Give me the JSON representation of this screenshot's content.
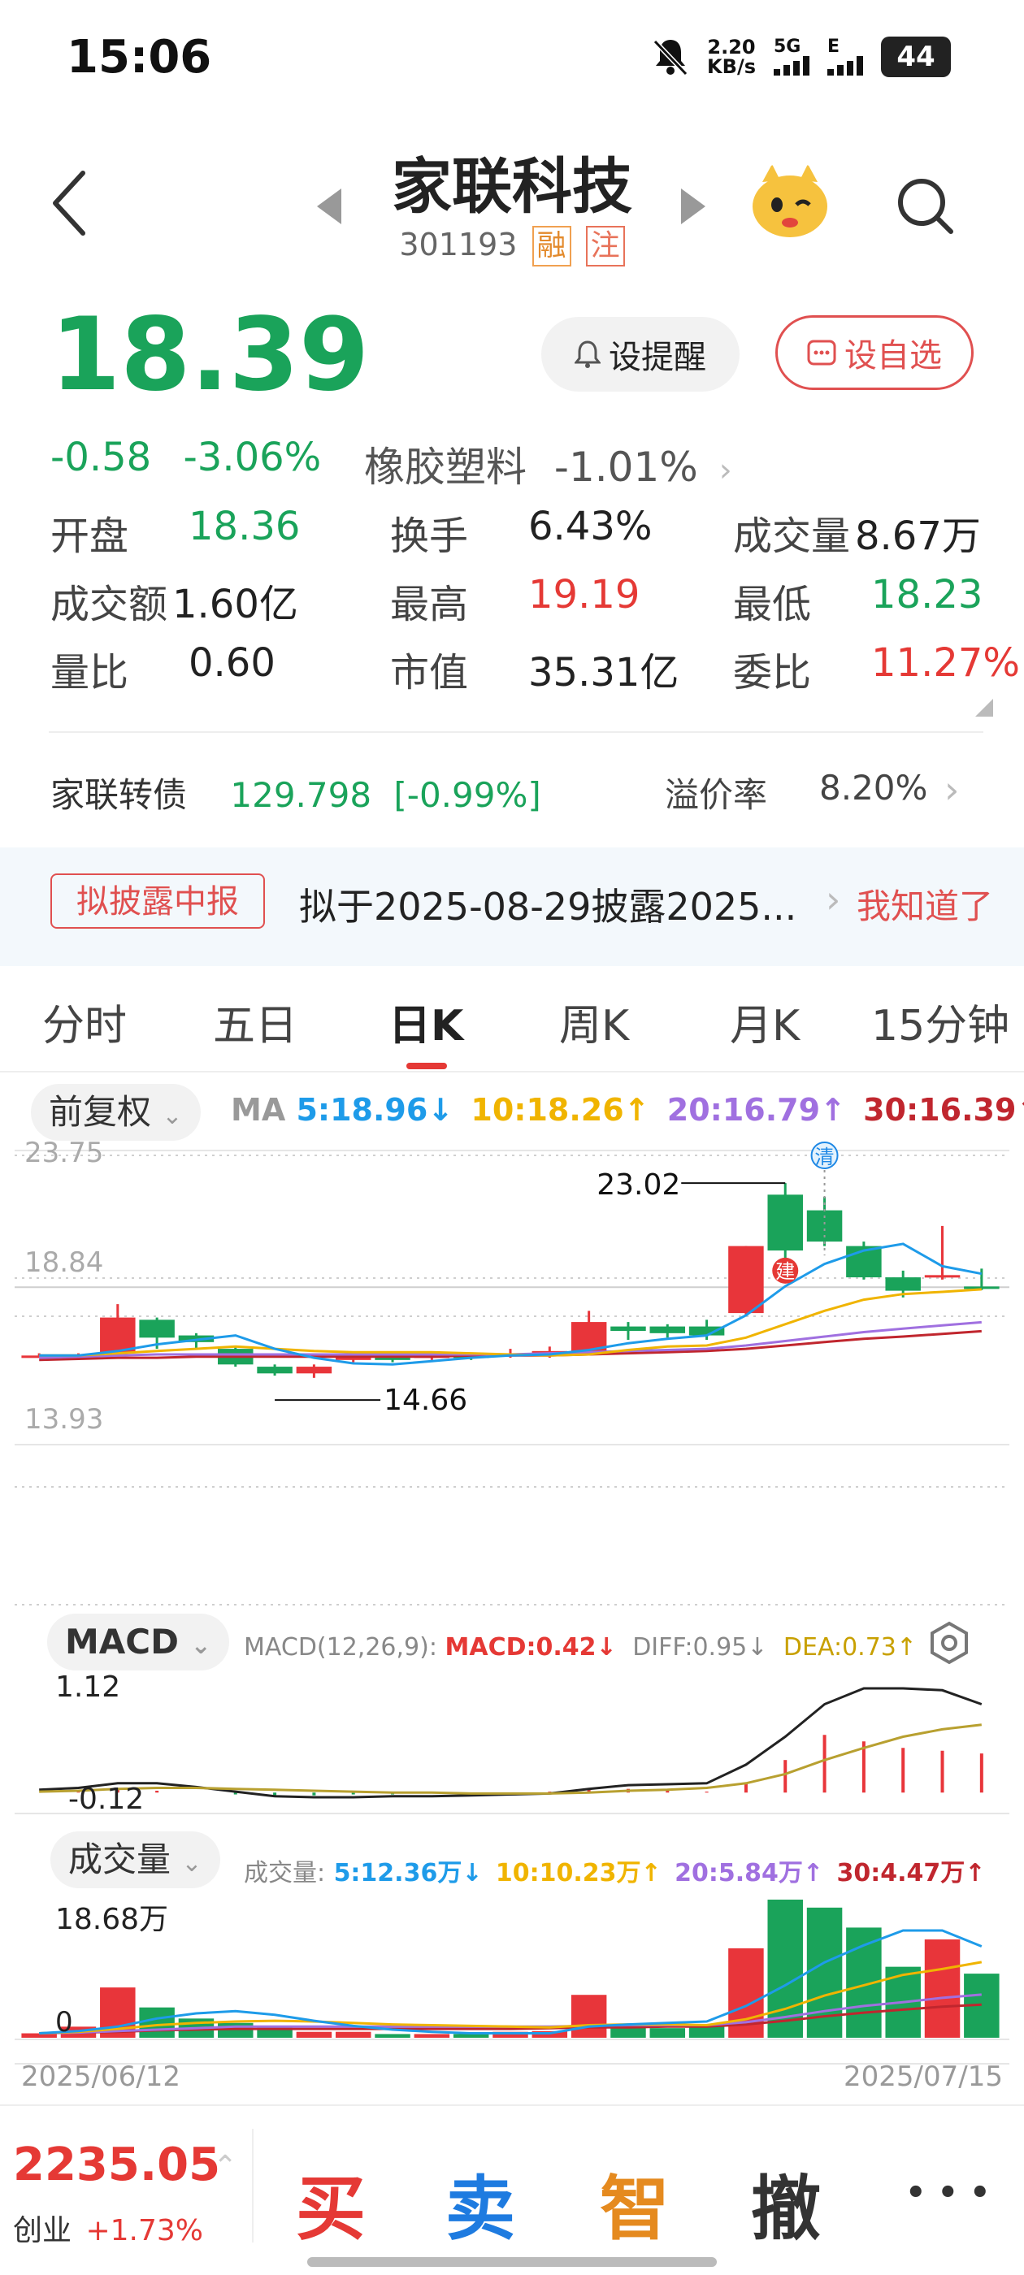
{
  "status_bar": {
    "time": "15:06",
    "net_speed_value": "2.20",
    "net_speed_unit": "KB/s",
    "net_5g": "5G",
    "net_e": "E",
    "battery": "44"
  },
  "header": {
    "title": "家联科技",
    "code": "301193",
    "tag_margin": "融",
    "tag_notice": "注"
  },
  "quote": {
    "price": "18.39",
    "change": "-0.58",
    "change_pct": "-3.06%",
    "industry_name": "橡胶塑料",
    "industry_pct": "-1.01%",
    "remind_label": "设提醒",
    "fav_label": "设自选"
  },
  "stats": [
    {
      "key": "开盘",
      "value": "18.36",
      "color": "#1aa35a"
    },
    {
      "key": "换手",
      "value": "6.43%",
      "color": "#222222"
    },
    {
      "key": "成交量",
      "value": "8.67万",
      "color": "#222222"
    },
    {
      "key": "成交额",
      "value": "1.60亿",
      "color": "#222222"
    },
    {
      "key": "最高",
      "value": "19.19",
      "color": "#e53935"
    },
    {
      "key": "最低",
      "value": "18.23",
      "color": "#1aa35a"
    },
    {
      "key": "量比",
      "value": "0.60",
      "color": "#222222"
    },
    {
      "key": "市值",
      "value": "35.31亿",
      "color": "#222222"
    },
    {
      "key": "委比",
      "value": "11.27%",
      "color": "#e53935"
    }
  ],
  "bond": {
    "name": "家联转债",
    "price": "129.798",
    "pct": "[-0.99%]",
    "premium_label": "溢价率",
    "premium": "8.20%"
  },
  "notice": {
    "tag": "拟披露中报",
    "text": "拟于2025-08-29披露2025...",
    "ack": "我知道了"
  },
  "tabs": [
    "分时",
    "五日",
    "日K",
    "周K",
    "月K",
    "15分钟"
  ],
  "active_tab": 2,
  "ma": {
    "adjust": "前复权",
    "label": "MA",
    "items": [
      {
        "text": "5:18.96↓",
        "color": "#1e9be9"
      },
      {
        "text": "10:18.26↑",
        "color": "#f0b400"
      },
      {
        "text": "20:16.79↑",
        "color": "#a070e0"
      },
      {
        "text": "30:16.39↑",
        "color": "#c0262e"
      }
    ]
  },
  "macd": {
    "label": "MACD",
    "params": "MACD(12,26,9):",
    "macd": "MACD:0.42↓",
    "diff": "DIFF:0.95↓",
    "dea": "DEA:0.73↑",
    "ymax": "1.12",
    "ymin": "-0.12"
  },
  "volume": {
    "label": "成交量",
    "prefix": "成交量:",
    "items": [
      {
        "text": "5:12.36万↓",
        "color": "#1e9be9"
      },
      {
        "text": "10:10.23万↑",
        "color": "#f0b400"
      },
      {
        "text": "20:5.84万↑",
        "color": "#a070e0"
      },
      {
        "text": "30:4.47万↑",
        "color": "#c0262e"
      }
    ],
    "ymax": "18.68万",
    "ymin": "0"
  },
  "chart_data": {
    "type": "candlestick",
    "ylim": [
      13.93,
      23.75
    ],
    "y_ticks": [
      "23.75",
      "18.84",
      "13.93"
    ],
    "start_date": "2025/06/12",
    "end_date": "2025/07/15",
    "hi_label": "23.02",
    "lo_label": "14.66",
    "markers": [
      "清",
      "建"
    ],
    "candles": [
      {
        "o": 15.3,
        "c": 15.3,
        "h": 15.4,
        "l": 15.2,
        "v": 0.6
      },
      {
        "o": 15.2,
        "c": 15.3,
        "h": 15.4,
        "l": 15.1,
        "v": 1.5
      },
      {
        "o": 15.4,
        "c": 17.0,
        "h": 17.6,
        "l": 15.3,
        "v": 6.8
      },
      {
        "o": 16.9,
        "c": 16.1,
        "h": 17.0,
        "l": 15.6,
        "v": 4.1
      },
      {
        "o": 16.2,
        "c": 15.9,
        "h": 16.3,
        "l": 15.6,
        "v": 2.6
      },
      {
        "o": 15.6,
        "c": 14.9,
        "h": 15.7,
        "l": 14.8,
        "v": 2.0
      },
      {
        "o": 14.8,
        "c": 14.5,
        "h": 14.9,
        "l": 14.4,
        "v": 1.5
      },
      {
        "o": 14.5,
        "c": 14.8,
        "h": 14.9,
        "l": 14.3,
        "v": 0.8
      },
      {
        "o": 15.1,
        "c": 15.3,
        "h": 15.4,
        "l": 15.0,
        "v": 0.8
      },
      {
        "o": 15.3,
        "c": 15.1,
        "h": 15.4,
        "l": 15.0,
        "v": 0.5
      },
      {
        "o": 15.2,
        "c": 15.3,
        "h": 15.4,
        "l": 15.1,
        "v": 0.5
      },
      {
        "o": 15.3,
        "c": 15.2,
        "h": 15.4,
        "l": 15.1,
        "v": 0.5
      },
      {
        "o": 15.3,
        "c": 15.4,
        "h": 15.6,
        "l": 15.2,
        "v": 0.8
      },
      {
        "o": 15.3,
        "c": 15.5,
        "h": 15.7,
        "l": 15.2,
        "v": 0.9
      },
      {
        "o": 15.4,
        "c": 16.8,
        "h": 17.3,
        "l": 15.3,
        "v": 5.8
      },
      {
        "o": 16.6,
        "c": 16.4,
        "h": 16.8,
        "l": 16.0,
        "v": 1.7
      },
      {
        "o": 16.6,
        "c": 16.3,
        "h": 16.7,
        "l": 16.1,
        "v": 1.3
      },
      {
        "o": 16.6,
        "c": 16.2,
        "h": 16.9,
        "l": 16.0,
        "v": 1.6
      },
      {
        "o": 17.2,
        "c": 20.2,
        "h": 20.2,
        "l": 17.1,
        "v": 12.1
      },
      {
        "o": 22.5,
        "c": 20.0,
        "h": 23.02,
        "l": 19.5,
        "v": 18.68
      },
      {
        "o": 21.8,
        "c": 20.4,
        "h": 22.4,
        "l": 20.2,
        "v": 17.6
      },
      {
        "o": 20.2,
        "c": 18.8,
        "h": 20.4,
        "l": 18.7,
        "v": 14.9
      },
      {
        "o": 18.8,
        "c": 18.2,
        "h": 19.1,
        "l": 17.9,
        "v": 9.6
      },
      {
        "o": 18.8,
        "c": 18.9,
        "h": 21.1,
        "l": 18.7,
        "v": 13.3
      },
      {
        "o": 18.39,
        "c": 18.36,
        "h": 19.19,
        "l": 18.23,
        "v": 8.67
      }
    ],
    "ma5": [
      15.3,
      15.3,
      15.5,
      15.8,
      16.0,
      16.2,
      15.6,
      15.2,
      14.95,
      14.9,
      15.05,
      15.2,
      15.3,
      15.35,
      15.55,
      15.85,
      16.05,
      16.2,
      17.1,
      18.4,
      19.4,
      20.0,
      20.3,
      19.3,
      18.96
    ],
    "ma10": [
      15.3,
      15.3,
      15.4,
      15.5,
      15.6,
      15.7,
      15.6,
      15.5,
      15.45,
      15.45,
      15.45,
      15.4,
      15.35,
      15.3,
      15.35,
      15.55,
      15.7,
      15.75,
      16.1,
      16.7,
      17.3,
      17.8,
      18.05,
      18.15,
      18.26
    ],
    "ma20": [
      15.2,
      15.25,
      15.3,
      15.35,
      15.35,
      15.35,
      15.35,
      15.35,
      15.35,
      15.35,
      15.35,
      15.35,
      15.35,
      15.4,
      15.45,
      15.5,
      15.55,
      15.6,
      15.75,
      15.95,
      16.15,
      16.35,
      16.5,
      16.65,
      16.79
    ],
    "ma30": [
      15.1,
      15.15,
      15.2,
      15.2,
      15.25,
      15.25,
      15.25,
      15.25,
      15.25,
      15.25,
      15.25,
      15.3,
      15.3,
      15.3,
      15.35,
      15.4,
      15.45,
      15.5,
      15.6,
      15.75,
      15.9,
      16.05,
      16.15,
      16.27,
      16.39
    ],
    "macd_hist": [
      0,
      0.01,
      0.03,
      0.02,
      0,
      -0.02,
      -0.03,
      -0.03,
      -0.02,
      -0.02,
      -0.01,
      -0.01,
      0,
      0.01,
      0.05,
      0.04,
      0.02,
      0.01,
      0.1,
      0.35,
      0.62,
      0.55,
      0.48,
      0.45,
      0.42
    ],
    "diff": [
      0.03,
      0.05,
      0.1,
      0.1,
      0.06,
      0.01,
      -0.04,
      -0.05,
      -0.05,
      -0.04,
      -0.04,
      -0.03,
      -0.02,
      -0.01,
      0.04,
      0.08,
      0.09,
      0.1,
      0.3,
      0.6,
      0.95,
      1.12,
      1.12,
      1.1,
      0.95
    ],
    "dea": [
      0.01,
      0.02,
      0.04,
      0.05,
      0.05,
      0.04,
      0.03,
      0.02,
      0.01,
      0.0,
      0.0,
      -0.01,
      -0.01,
      -0.01,
      0.0,
      0.02,
      0.03,
      0.05,
      0.1,
      0.2,
      0.35,
      0.48,
      0.6,
      0.68,
      0.73
    ],
    "vol_ma5": [
      0.6,
      0.9,
      1.5,
      2.6,
      3.3,
      3.6,
      3.1,
      2.3,
      1.6,
      1.1,
      0.8,
      0.6,
      0.6,
      0.6,
      1.5,
      1.8,
      2.0,
      2.2,
      4.3,
      7.1,
      10.2,
      12.5,
      14.5,
      14.5,
      12.36
    ],
    "vol_ma10": [
      0.6,
      0.8,
      1.2,
      1.7,
      2.0,
      2.2,
      2.3,
      2.2,
      2.0,
      1.8,
      1.7,
      1.6,
      1.5,
      1.4,
      1.7,
      1.8,
      1.8,
      1.7,
      2.5,
      3.9,
      5.7,
      7.1,
      8.5,
      9.3,
      10.23
    ],
    "vol_ma20": [
      0.6,
      0.7,
      0.9,
      1.1,
      1.3,
      1.5,
      1.5,
      1.5,
      1.5,
      1.5,
      1.5,
      1.5,
      1.5,
      1.5,
      1.6,
      1.7,
      1.7,
      1.7,
      2.1,
      2.8,
      3.6,
      4.3,
      4.8,
      5.4,
      5.84
    ],
    "vol_ma30": [
      0.6,
      0.7,
      0.8,
      1.0,
      1.1,
      1.2,
      1.2,
      1.2,
      1.2,
      1.2,
      1.2,
      1.2,
      1.2,
      1.3,
      1.4,
      1.4,
      1.5,
      1.5,
      1.8,
      2.3,
      2.9,
      3.4,
      3.8,
      4.2,
      4.47
    ]
  },
  "footer": {
    "index_value": "2235.05",
    "index_name": "创业",
    "index_pct": "+1.73%",
    "buy": "买",
    "sell": "卖",
    "smart": "智",
    "cancel": "撤",
    "more": "• • •"
  }
}
